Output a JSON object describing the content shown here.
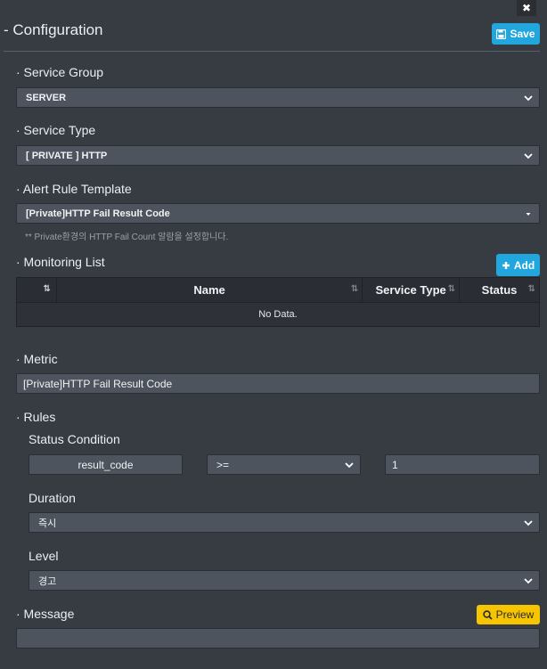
{
  "window": {
    "close_glyph": "✖"
  },
  "header": {
    "title": "- Configuration",
    "save_label": "Save"
  },
  "service_group": {
    "label": "· Service Group",
    "value": "SERVER"
  },
  "service_type": {
    "label": "· Service Type",
    "value": "[ PRIVATE ] HTTP"
  },
  "alert_rule_template": {
    "label": "· Alert Rule Template",
    "value": "[Private]HTTP Fail Result Code",
    "hint": "** Private환경의 HTTP Fail Count 알람을 설정합니다."
  },
  "monitoring_list": {
    "label": "· Monitoring List",
    "add_label": "Add",
    "columns": [
      "Name",
      "Service Type",
      "Status"
    ],
    "empty_text": "No Data."
  },
  "metric": {
    "label": "· Metric",
    "value": "[Private]HTTP Fail Result Code"
  },
  "rules": {
    "label": "· Rules",
    "status_condition": {
      "label": "Status Condition",
      "field": "result_code",
      "operator": ">=",
      "value": "1"
    },
    "duration": {
      "label": "Duration",
      "value": "즉시"
    },
    "level": {
      "label": "Level",
      "value": "경고"
    }
  },
  "message": {
    "label": "· Message",
    "preview_label": "Preview",
    "value": ""
  },
  "colors": {
    "accent_blue": "#21a6dd",
    "accent_yellow": "#f7c400",
    "background": "#373c43"
  },
  "icons": {
    "close": "close-icon",
    "save": "floppy-disk-icon",
    "add": "plus-icon",
    "preview": "search-icon",
    "dropdown": "chevron-down-icon",
    "sort": "sort-arrows-icon"
  }
}
